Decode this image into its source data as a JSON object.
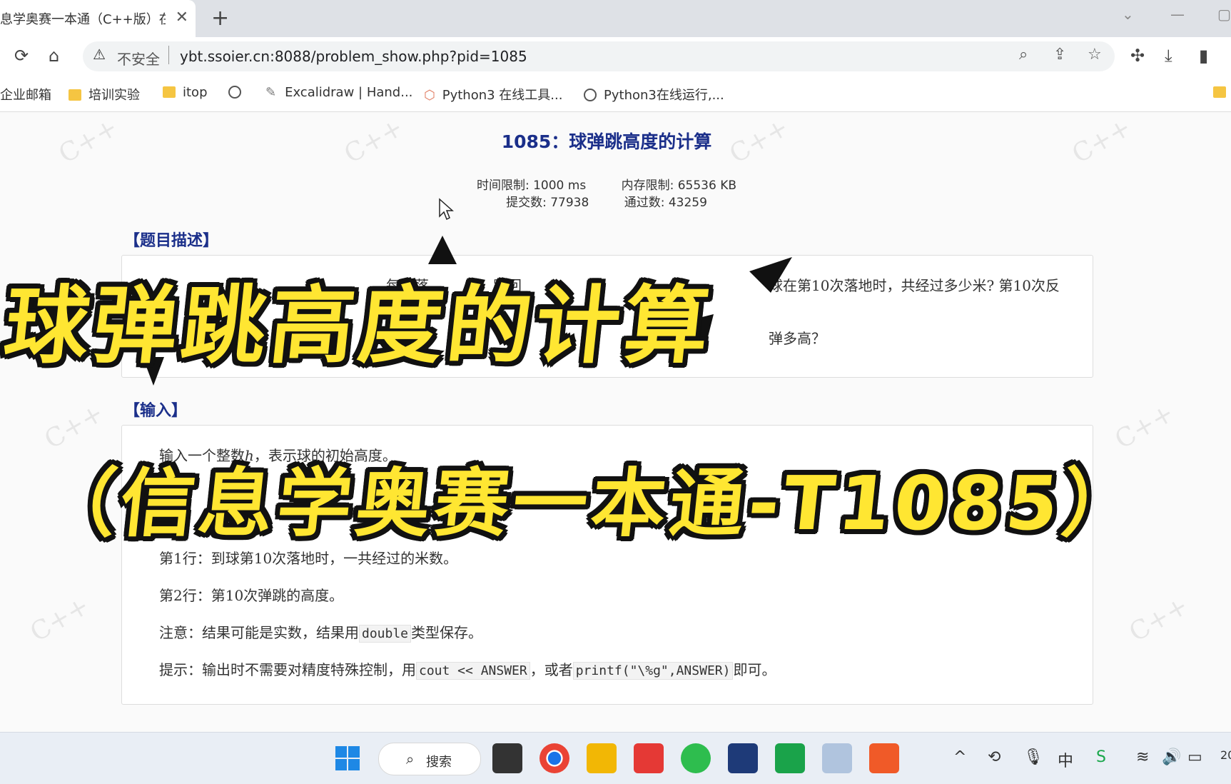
{
  "browser": {
    "tab_title": "息学奥赛一本通（C++版）在线",
    "tab_close": "✕",
    "new_tab": "+",
    "security_label": "不安全",
    "url": "ybt.ssoier.cn:8088/problem_show.php?pid=1085",
    "bookmarks": [
      {
        "label": "企业邮箱",
        "icon": "none"
      },
      {
        "label": "培训实验",
        "icon": "folder-icon"
      },
      {
        "label": "itop",
        "icon": "folder-icon"
      },
      {
        "label": "",
        "icon": "globe-icon"
      },
      {
        "label": "Excalidraw | Hand...",
        "icon": "excalidraw-icon"
      },
      {
        "label": "Python3 在线工具...",
        "icon": "python-tool-icon"
      },
      {
        "label": "Python3在线运行,...",
        "icon": "globe-icon"
      }
    ]
  },
  "problem": {
    "title": "1085：球弹跳高度的计算",
    "time_limit": "时间限制: 1000 ms",
    "memory_limit": "内存限制: 65536 KB",
    "submissions": "提交数: 77938",
    "accepted": "通过数: 43259",
    "desc_head": "【题目描述】",
    "desc_line1_a": "每次落",
    "desc_line1_b": "跳回",
    "desc_line1_c": "球在第10次落地时，共经过多少米? 第10次反",
    "desc_line2": "弹多高？",
    "input_head": "【输入】",
    "input_line_a": "输入一个整数",
    "input_var": "h",
    "input_line_b": "，表示球的初始高度。",
    "output_line1": "第1行：到球第10次落地时，一共经过的米数。",
    "output_line2": "第2行：第10次弹跳的高度。",
    "note_prefix": "注意：结果可能是实数，结果用",
    "note_code": "double",
    "note_suffix": "类型保存。",
    "hint_prefix": "提示：输出时不需要对精度特殊控制，用",
    "hint_code1": "cout << ANSWER",
    "hint_mid": "，或者",
    "hint_code2": "printf(\"\\%g\",ANSWER)",
    "hint_suffix": "即可。"
  },
  "overlay": {
    "line1": "球弹跳高度的计算",
    "line2": "（信息学奥赛一本通-T1085）"
  },
  "taskbar": {
    "search_label": "搜索",
    "clock_partial": "20"
  },
  "colors": {
    "title_blue": "#1b2f8a",
    "overlay_yellow": "#ffe632",
    "overlay_outline": "#111111"
  }
}
